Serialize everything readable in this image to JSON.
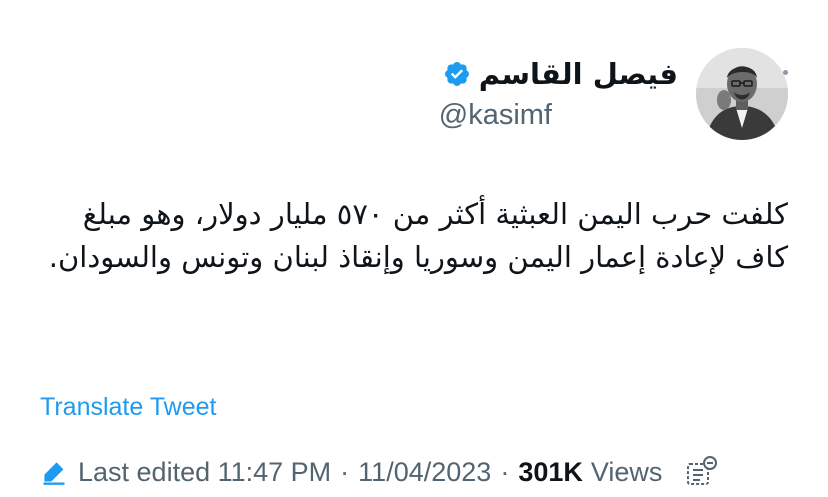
{
  "author": {
    "display_name": "فيصل القاسم",
    "handle": "@kasimf",
    "verified": true,
    "avatar_icon": "profile-photo"
  },
  "tweet": {
    "text": "كلفت حرب اليمن العبثية أكثر من ٥٧٠ مليار دولار، وهو مبلغ كاف لإعادة إعمار اليمن وسوريا وإنقاذ لبنان وتونس والسودان."
  },
  "actions": {
    "translate_label": "Translate Tweet",
    "more_icon": "more-horizontal-icon"
  },
  "meta": {
    "edited_label": "Last edited 11:47 PM",
    "separator": "·",
    "date": "11/04/2023",
    "views_count": "301K",
    "views_label": "Views"
  },
  "colors": {
    "accent": "#1d9bf0",
    "secondary_text": "#536471",
    "primary_text": "#0f1419"
  }
}
